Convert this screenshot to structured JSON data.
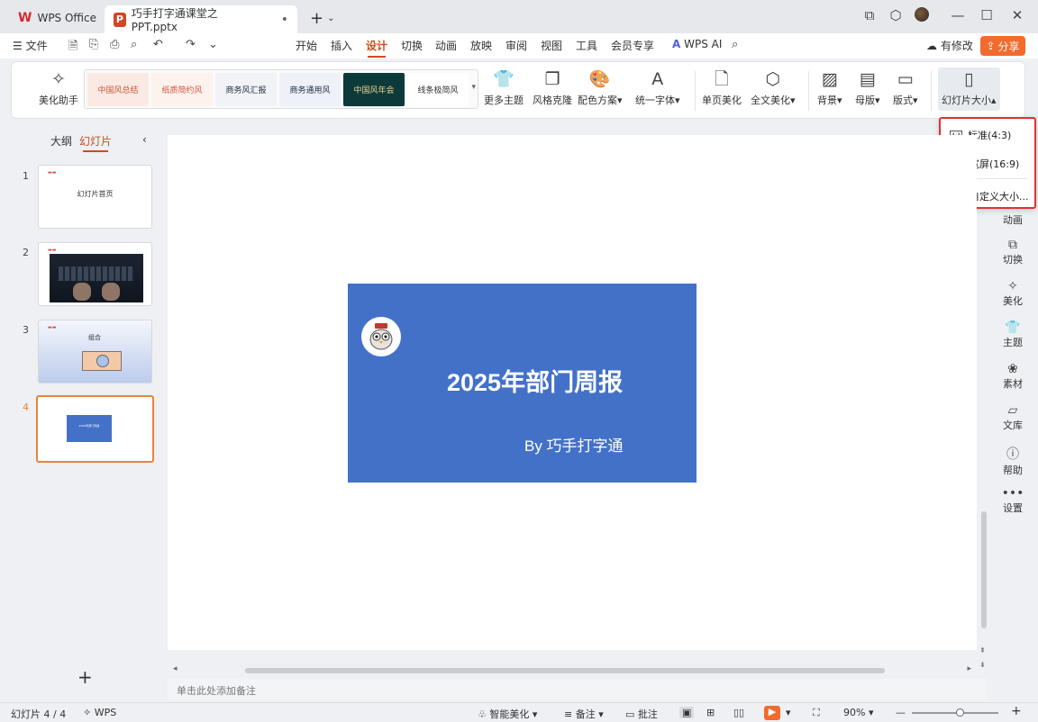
{
  "tabs": {
    "home_label": "WPS Office",
    "doc_label": "巧手打字通课堂之PPT.pptx",
    "ppt_badge": "P",
    "wps_badge": "W"
  },
  "menu": {
    "file": "文件",
    "items": [
      "开始",
      "插入",
      "设计",
      "切换",
      "动画",
      "放映",
      "审阅",
      "视图",
      "工具",
      "会员专享"
    ],
    "active_index": 2,
    "wps_ai": "WPS AI",
    "has_changes": "有修改",
    "share": "分享"
  },
  "ribbon": {
    "beautify_assistant": "美化助手",
    "themes": [
      {
        "label": "中国风总结",
        "bg": "#fbeae3",
        "fg": "#c9553a"
      },
      {
        "label": "纸质简约风",
        "bg": "#fdf2ee",
        "fg": "#d8523c"
      },
      {
        "label": "商务风汇报",
        "bg": "#f1f3f6",
        "fg": "#1f2a44"
      },
      {
        "label": "商务通用风",
        "bg": "#eef1f7",
        "fg": "#1f2a44"
      },
      {
        "label": "中国风年会",
        "bg": "#0c3a3b",
        "fg": "#f2d28a"
      },
      {
        "label": "线条极简风",
        "bg": "#ffffff",
        "fg": "#333333"
      }
    ],
    "more_themes": "更多主题",
    "style_clone": "风格克隆",
    "color_scheme": "配色方案",
    "unify_font": "统一字体",
    "single_page_beautify": "单页美化",
    "full_text_beautify": "全文美化",
    "background": "背景",
    "master": "母版",
    "layout": "版式",
    "slide_size": "幻灯片大小"
  },
  "slide_size_menu": {
    "standard": "标准(4:3)",
    "widescreen": "宽屏(16:9)",
    "custom": "自定义大小...",
    "badge_43": "4:3"
  },
  "left_panel": {
    "outline_tab": "大纲",
    "slides_tab": "幻灯片",
    "slides": [
      {
        "num": "1",
        "text": "幻灯片首页"
      },
      {
        "num": "2",
        "text": ""
      },
      {
        "num": "3",
        "text": "组合"
      },
      {
        "num": "4",
        "text": "2025年部门周报"
      }
    ],
    "selected_index": 3,
    "add_label": "+"
  },
  "slide": {
    "title": "2025年部门周报",
    "subtitle": "By 巧手打字通",
    "bg_color": "#4471c8"
  },
  "right_sidebar": {
    "items": [
      "动画",
      "切换",
      "美化",
      "主题",
      "素材",
      "文库",
      "帮助",
      "设置"
    ]
  },
  "notes_placeholder": "单击此处添加备注",
  "status": {
    "slide_counter": "幻灯片 4 / 4",
    "wps": "WPS",
    "smart_beautify": "智能美化",
    "notes": "备注",
    "comments": "批注",
    "zoom": "90%",
    "zoom_level": 0.55
  }
}
